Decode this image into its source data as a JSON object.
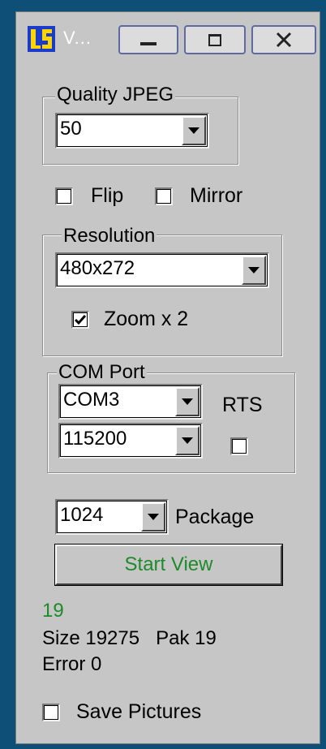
{
  "window": {
    "title": "V...",
    "accent": "#0e4f77",
    "status_green": "#1f8a2a"
  },
  "quality": {
    "label": "Quality JPEG",
    "value": "50"
  },
  "options": {
    "flip": {
      "label": "Flip",
      "checked": false
    },
    "mirror": {
      "label": "Mirror",
      "checked": false
    }
  },
  "resolution": {
    "label": "Resolution",
    "value": "480x272",
    "zoom": {
      "label": "Zoom x 2",
      "checked": true
    }
  },
  "com": {
    "label": "COM Port",
    "port": "COM3",
    "baud": "115200",
    "rts": {
      "label": "RTS",
      "checked": false
    }
  },
  "package": {
    "value": "1024",
    "label": "Package"
  },
  "start_button": {
    "label": "Start View"
  },
  "status": {
    "count": "19",
    "size_line": "Size 19275   Pak 19",
    "error_line": "Error 0"
  },
  "save": {
    "label": "Save Pictures",
    "checked": false
  }
}
